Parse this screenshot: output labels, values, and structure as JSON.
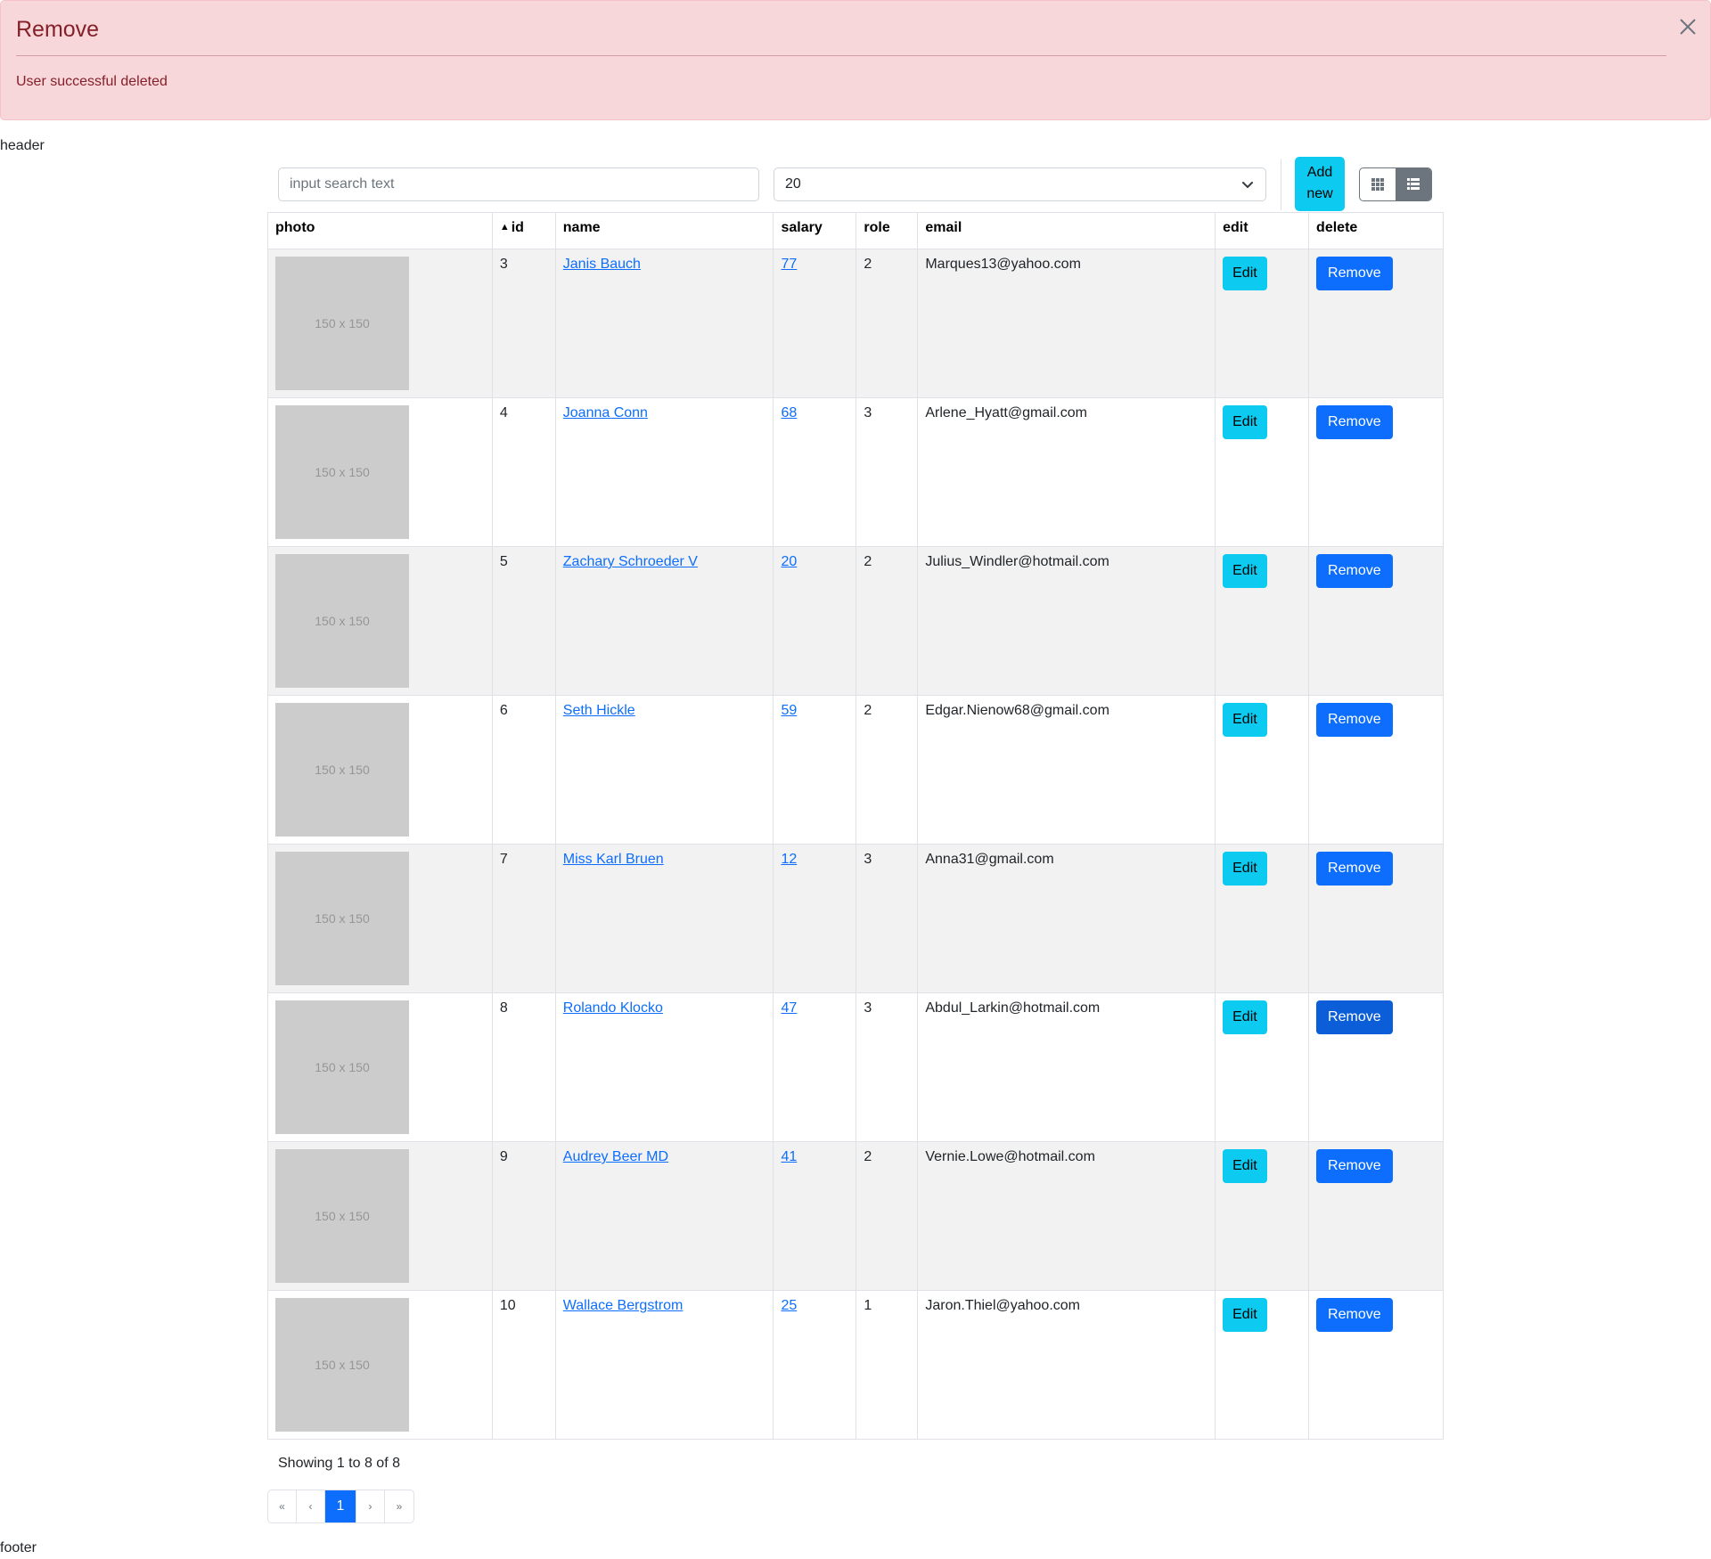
{
  "alert": {
    "title": "Remove",
    "message": "User successful deleted",
    "close_icon": "close-icon"
  },
  "layout_text": {
    "header": "header",
    "footer": "footer"
  },
  "toolbar": {
    "search_placeholder": "input search text",
    "page_size": "20",
    "add_new_label": "Add new",
    "view_modes": [
      "grid-view-icon",
      "list-view-icon"
    ],
    "active_view": "list"
  },
  "table": {
    "columns": [
      "photo",
      "id",
      "name",
      "salary",
      "role",
      "email",
      "edit",
      "delete"
    ],
    "sorted_column": "id",
    "photo_placeholder": "150 x 150",
    "edit_label": "Edit",
    "remove_label": "Remove",
    "rows": [
      {
        "id": "3",
        "name": "Janis Bauch",
        "salary": "77",
        "role": "2",
        "email": "Marques13@yahoo.com"
      },
      {
        "id": "4",
        "name": "Joanna Conn",
        "salary": "68",
        "role": "3",
        "email": "Arlene_Hyatt@gmail.com"
      },
      {
        "id": "5",
        "name": "Zachary Schroeder V",
        "salary": "20",
        "role": "2",
        "email": "Julius_Windler@hotmail.com"
      },
      {
        "id": "6",
        "name": "Seth Hickle",
        "salary": "59",
        "role": "2",
        "email": "Edgar.Nienow68@gmail.com"
      },
      {
        "id": "7",
        "name": "Miss Karl Bruen",
        "salary": "12",
        "role": "3",
        "email": "Anna31@gmail.com"
      },
      {
        "id": "8",
        "name": "Rolando Klocko",
        "salary": "47",
        "role": "3",
        "email": "Abdul_Larkin@hotmail.com"
      },
      {
        "id": "9",
        "name": "Audrey Beer MD",
        "salary": "41",
        "role": "2",
        "email": "Vernie.Lowe@hotmail.com"
      },
      {
        "id": "10",
        "name": "Wallace Bergstrom",
        "salary": "25",
        "role": "1",
        "email": "Jaron.Thiel@yahoo.com"
      }
    ]
  },
  "pagination": {
    "summary": "Showing 1 to 8 of 8",
    "first": "«",
    "prev": "‹",
    "current": "1",
    "next": "›",
    "last": "»"
  },
  "colors": {
    "alert_bg": "#f8d7da",
    "alert_text": "#842029",
    "info": "#0dcaf0",
    "primary": "#0d6efd",
    "secondary": "#6c757d"
  }
}
